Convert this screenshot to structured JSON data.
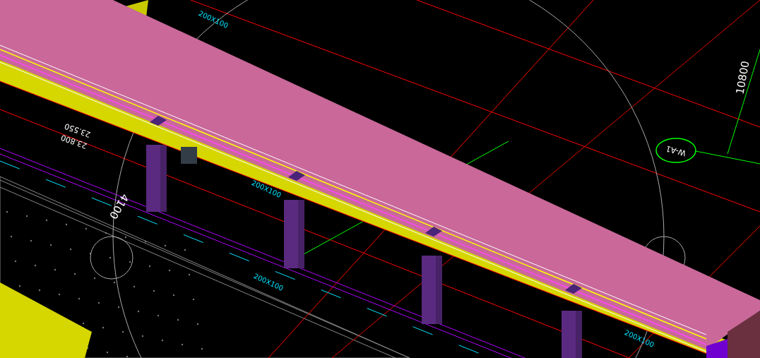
{
  "viewport": {
    "labels": [
      {
        "kind": "dimension",
        "text": "10800"
      },
      {
        "kind": "axis",
        "text": "W-A1"
      },
      {
        "kind": "elevation",
        "text": "23.550"
      },
      {
        "kind": "elevation",
        "text": "23.800"
      },
      {
        "kind": "dimension",
        "text": "4100"
      },
      {
        "kind": "note",
        "text": "200X100"
      },
      {
        "kind": "note",
        "text": "200X100"
      },
      {
        "kind": "note",
        "text": "200X100"
      },
      {
        "kind": "note",
        "text": "200X100"
      }
    ]
  }
}
